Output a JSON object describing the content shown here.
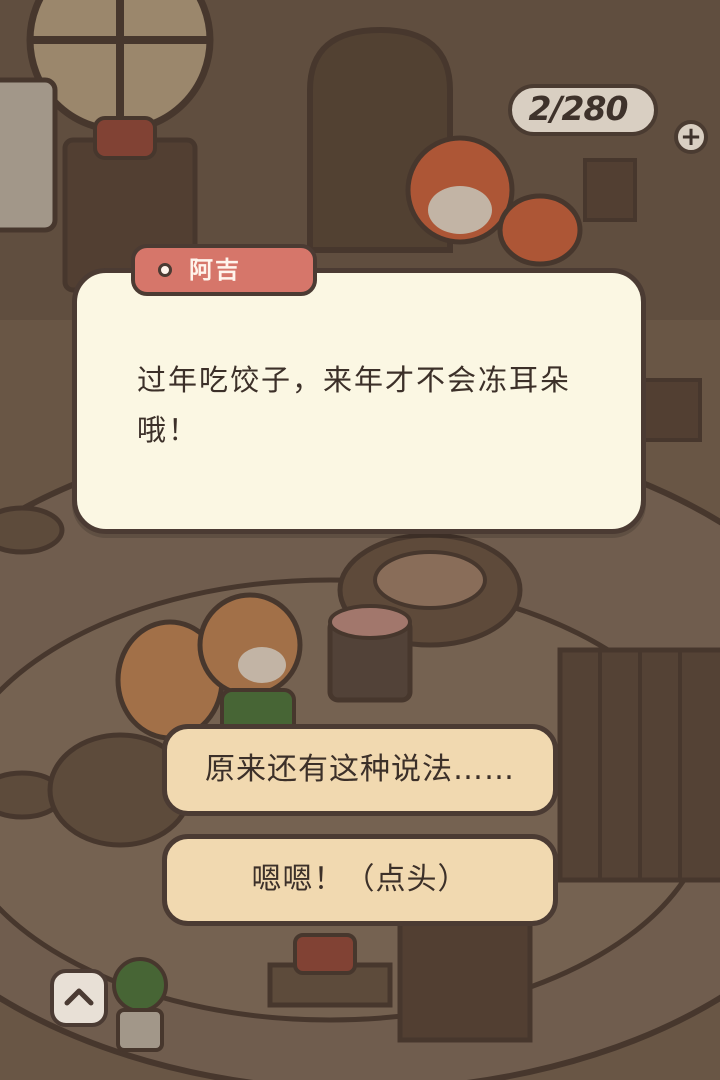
{
  "hud": {
    "currency_value": "2/280",
    "plus_symbol": "+"
  },
  "dialog": {
    "speaker": "阿吉",
    "text": "过年吃饺子，来年才不会冻耳朵哦！"
  },
  "choices": [
    {
      "label": "原来还有这种说法……"
    },
    {
      "label": "嗯嗯！（点头）"
    }
  ],
  "icons": {
    "up_button": "chevron-up-icon",
    "plus_button": "plus-icon",
    "speaker_dot": "dot-icon"
  },
  "colors": {
    "dialog_bg": "#fbf7e3",
    "nameplate": "#d6766a",
    "choice_bg": "#f1d9b0",
    "outline": "#4b3b33"
  }
}
